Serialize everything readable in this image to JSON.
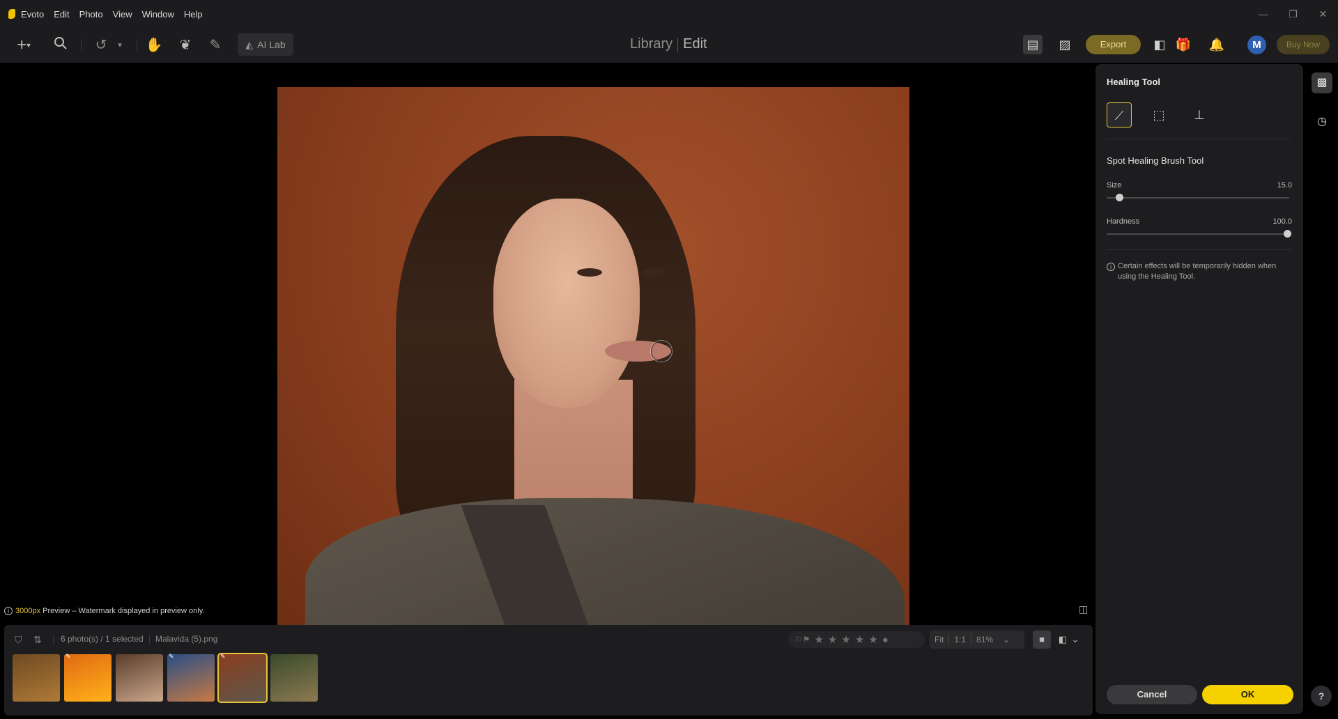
{
  "app": {
    "name": "Evoto"
  },
  "menu": [
    "Edit",
    "Photo",
    "View",
    "Window",
    "Help"
  ],
  "window_controls": {
    "minimize": "—",
    "restore": "❐",
    "close": "✕"
  },
  "toolbar": {
    "ailab_label": "AI Lab",
    "mode_library": "Library",
    "mode_edit": "Edit",
    "export_label": "Export",
    "buy_now_label": "Buy Now",
    "avatar_initial": "M"
  },
  "canvas": {
    "preview_px": "3000px",
    "preview_note": " Preview – Watermark displayed in preview only."
  },
  "filmstrip": {
    "count_text": "6 photo(s) / 1 selected",
    "filename": "Malavida (5).png",
    "zoom_fit": "Fit",
    "zoom_one": "1:1",
    "zoom_percent": "81%",
    "rating_stars": 5,
    "thumbs": [
      {
        "colors": [
          "#6e4a22",
          "#b07a36"
        ],
        "edited": false,
        "selected": false
      },
      {
        "colors": [
          "#e06a12",
          "#ffb21a"
        ],
        "edited": true,
        "selected": false
      },
      {
        "colors": [
          "#5a3d2b",
          "#c9a68a"
        ],
        "edited": false,
        "selected": false
      },
      {
        "colors": [
          "#2a4e86",
          "#c67a44"
        ],
        "edited": true,
        "selected": false
      },
      {
        "colors": [
          "#8a3e1e",
          "#5f574c"
        ],
        "edited": true,
        "selected": true
      },
      {
        "colors": [
          "#3a4a2a",
          "#8c7a52"
        ],
        "edited": false,
        "selected": false
      }
    ]
  },
  "panel": {
    "title": "Healing Tool",
    "subtitle": "Spot Healing Brush Tool",
    "size_label": "Size",
    "size_value": "15.0",
    "size_fraction": 0.07,
    "hardness_label": "Hardness",
    "hardness_value": "100.0",
    "hardness_fraction": 1.0,
    "notice": "Certain effects will be temporarily hidden when using the Healing Tool.",
    "cancel_label": "Cancel",
    "ok_label": "OK"
  },
  "colors": {
    "accent": "#f5d100",
    "export": "#7b6a24",
    "panel_bg": "#1d1d1f"
  }
}
